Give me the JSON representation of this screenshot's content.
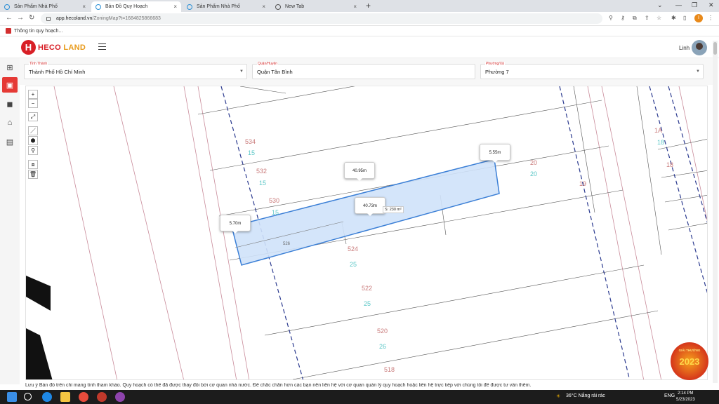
{
  "browser": {
    "tabs": [
      {
        "title": "Sản Phẩm Nhà Phố"
      },
      {
        "title": "Bản Đồ Quy Hoạch"
      },
      {
        "title": "Sản Phẩm Nhà Phố"
      },
      {
        "title": "New Tab"
      }
    ],
    "url_host": "app.hecoland.vn",
    "url_path": "/ZoningMap?t=1684825866683",
    "bookmark": "Thông tin quy hoạch..."
  },
  "header": {
    "logo_h": "H",
    "logo_text_a": "HECO ",
    "logo_text_b": "LAND",
    "username": "Linh"
  },
  "filters": {
    "province": {
      "label": "Tỉnh Thành",
      "value": "Thành Phố Hồ Chí Minh"
    },
    "district": {
      "label": "Quận/Huyện",
      "value": "Quận Tân Bình"
    },
    "ward": {
      "label": "Phường/Xã",
      "value": "Phường 7"
    }
  },
  "map": {
    "controls": [
      "+",
      "−",
      "⤢",
      "／",
      "⬢",
      "⚲",
      "⧈",
      "🗑"
    ],
    "measurements": {
      "top_edge": "40.95m",
      "right_edge": "5.55m",
      "left_edge": "5.70m",
      "bottom_edge": "40.73m",
      "area": "S: 230 m²"
    },
    "parcels": [
      {
        "no": "534",
        "sub": "15"
      },
      {
        "no": "532",
        "sub": "15"
      },
      {
        "no": "530",
        "sub": "15"
      },
      {
        "no": "524",
        "sub": "25"
      },
      {
        "no": "522",
        "sub": "25"
      },
      {
        "no": "520",
        "sub": "26"
      },
      {
        "no": "518",
        "sub": ""
      },
      {
        "no": "1A",
        "sub": "18"
      },
      {
        "no": "20",
        "sub": "20"
      },
      {
        "no": "19",
        "sub": ""
      },
      {
        "no": "18",
        "sub": ""
      },
      {
        "no": "526",
        "sub": ""
      }
    ],
    "badge_top": "GIẢI THƯỞNG",
    "badge_year": "2023"
  },
  "notice": "Lưu ý Bản đồ trên chỉ mang tính tham khảo. Quy hoạch có thể đã được thay đổi bởi cơ quan nhà nước. Để chắc chắn hơn các bạn nên liên hệ với cơ quan quản lý quy hoạch hoặc liên hệ trực tiếp với chúng tôi để được tư vấn thêm.",
  "taskbar": {
    "weather": "36°C  Nắng rải rác",
    "lang": "ENG",
    "time": "2:14 PM",
    "date": "5/23/2023"
  },
  "colors": {
    "brand_red": "#d81f26",
    "brand_orange": "#e89a1a",
    "selection_fill": "#cfe2fa",
    "selection_stroke": "#3b7fd6",
    "lot_lines": "#2b3a8f"
  }
}
